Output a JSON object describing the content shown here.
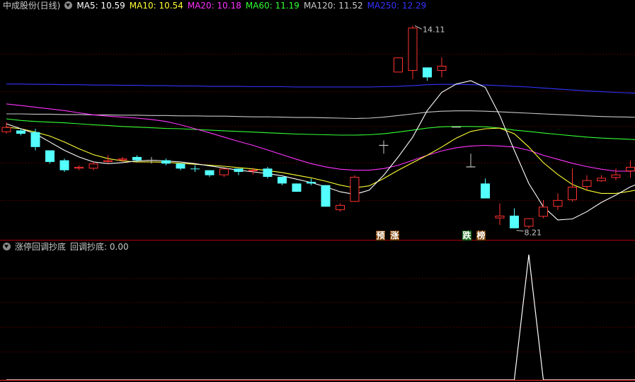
{
  "header": {
    "stock_name": "中成股份(日线)",
    "ma_labels": [
      {
        "text": "MA5: 10.59",
        "color": "#ffffff"
      },
      {
        "text": "MA10: 10.54",
        "color": "#ffff33"
      },
      {
        "text": "MA20: 10.18",
        "color": "#ff33ff"
      },
      {
        "text": "MA60: 11.19",
        "color": "#33ff33"
      },
      {
        "text": "MA120: 11.52",
        "color": "#c8c8c8"
      },
      {
        "text": "MA250: 12.29",
        "color": "#3333ff"
      }
    ]
  },
  "indicator": {
    "name": "涨停回调抄底",
    "value_label": "回调抄底: 0.00"
  },
  "signals": {
    "yu": "预",
    "zhang": "涨",
    "die": "跌",
    "bang": "榜"
  },
  "annotations": {
    "high": "14.11",
    "low": "8.21"
  },
  "colors": {
    "up": "#ff3232",
    "down": "#54ffff",
    "grid": "#7a0000",
    "separator": "#b00000",
    "ma5": "#ffffff",
    "ma10": "#ffff33",
    "ma20": "#ff33ff",
    "ma60": "#33ff33",
    "ma120": "#c8c8c8",
    "ma250": "#3333ff"
  },
  "chart_data": {
    "type": "candlestick",
    "ylim": [
      7.95,
      14.5
    ],
    "candles": [
      {
        "o": 10.9,
        "c": 11.05,
        "h": 11.2,
        "l": 10.85
      },
      {
        "o": 10.95,
        "c": 10.85,
        "h": 11.0,
        "l": 10.8
      },
      {
        "o": 10.9,
        "c": 10.45,
        "h": 11.0,
        "l": 10.35
      },
      {
        "o": 10.35,
        "c": 10.0,
        "h": 10.35,
        "l": 9.95
      },
      {
        "o": 10.05,
        "c": 9.75,
        "h": 10.1,
        "l": 9.7
      },
      {
        "o": 9.8,
        "c": 9.85,
        "h": 9.9,
        "l": 9.75
      },
      {
        "o": 9.8,
        "c": 9.95,
        "h": 10.0,
        "l": 9.75
      },
      {
        "o": 10.0,
        "c": 10.05,
        "h": 10.2,
        "l": 9.95
      },
      {
        "o": 10.05,
        "c": 10.1,
        "h": 10.15,
        "l": 10.0
      },
      {
        "o": 10.15,
        "c": 10.05,
        "h": 10.2,
        "l": 10.0
      },
      {
        "o": 10.05,
        "c": 10.05,
        "h": 10.15,
        "l": 9.95
      },
      {
        "o": 10.05,
        "c": 9.95,
        "h": 10.1,
        "l": 9.9
      },
      {
        "o": 9.95,
        "c": 9.8,
        "h": 9.95,
        "l": 9.75
      },
      {
        "o": 9.8,
        "c": 9.78,
        "h": 9.9,
        "l": 9.7
      },
      {
        "o": 9.75,
        "c": 9.6,
        "h": 9.75,
        "l": 9.55
      },
      {
        "o": 9.6,
        "c": 9.8,
        "h": 9.8,
        "l": 9.55
      },
      {
        "o": 9.8,
        "c": 9.7,
        "h": 9.8,
        "l": 9.6
      },
      {
        "o": 9.72,
        "c": 9.76,
        "h": 9.82,
        "l": 9.62
      },
      {
        "o": 9.8,
        "c": 9.55,
        "h": 9.85,
        "l": 9.5
      },
      {
        "o": 9.55,
        "c": 9.35,
        "h": 9.55,
        "l": 9.3
      },
      {
        "o": 9.35,
        "c": 9.1,
        "h": 9.35,
        "l": 9.1
      },
      {
        "o": 9.4,
        "c": 9.35,
        "h": 9.5,
        "l": 9.3
      },
      {
        "o": 9.3,
        "c": 8.65,
        "h": 9.3,
        "l": 8.65
      },
      {
        "o": 8.55,
        "c": 8.7,
        "h": 8.75,
        "l": 8.5
      },
      {
        "o": 8.8,
        "c": 9.55,
        "h": 9.6,
        "l": 8.8
      },
      {
        "o": null,
        "c": null,
        "h": null,
        "l": null
      },
      {
        "o": 10.5,
        "c": 10.5,
        "h": 10.65,
        "l": 10.25
      },
      {
        "o": 12.7,
        "c": 13.15,
        "h": 13.15,
        "l": 12.7
      },
      {
        "o": 12.75,
        "c": 14.05,
        "h": 14.11,
        "l": 12.5
      },
      {
        "o": 12.85,
        "c": 12.55,
        "h": 12.85,
        "l": 12.45
      },
      {
        "o": 12.75,
        "c": 12.9,
        "h": 13.15,
        "l": 12.55
      },
      {
        "o": 11.05,
        "c": 11.05,
        "h": 11.05,
        "l": 11.05
      },
      {
        "o": 9.85,
        "c": 9.85,
        "h": 10.25,
        "l": 9.85
      },
      {
        "o": 9.35,
        "c": 8.9,
        "h": 9.5,
        "l": 8.9
      },
      {
        "o": 8.3,
        "c": 8.38,
        "h": 8.75,
        "l": 8.1
      },
      {
        "o": 8.38,
        "c": 8.0,
        "h": 8.6,
        "l": 8.0
      },
      {
        "o": 8.05,
        "c": 8.3,
        "h": 8.3,
        "l": 8.0
      },
      {
        "o": 8.35,
        "c": 8.65,
        "h": 8.85,
        "l": 8.3
      },
      {
        "o": 8.65,
        "c": 8.85,
        "h": 9.05,
        "l": 8.55
      },
      {
        "o": 8.85,
        "c": 9.25,
        "h": 9.8,
        "l": 8.8
      },
      {
        "o": 9.25,
        "c": 9.45,
        "h": 9.6,
        "l": 9.15
      },
      {
        "o": 9.42,
        "c": 9.52,
        "h": 9.6,
        "l": 9.4
      },
      {
        "o": 9.52,
        "c": 9.62,
        "h": 9.8,
        "l": 9.45
      },
      {
        "o": 9.72,
        "c": 9.85,
        "h": 10.05,
        "l": 9.52
      },
      {
        "o": 9.85,
        "c": 9.55,
        "h": 10.1,
        "l": 9.55
      }
    ],
    "ma5": [
      11.15,
      11.0,
      10.85,
      10.6,
      10.35,
      10.15,
      10.0,
      9.95,
      9.98,
      10.03,
      10.05,
      10.03,
      10.0,
      9.95,
      9.88,
      9.82,
      9.75,
      9.7,
      9.65,
      9.58,
      9.48,
      9.38,
      9.25,
      9.1,
      9.02,
      9.15,
      9.6,
      10.15,
      10.75,
      11.55,
      12.1,
      12.35,
      12.45,
      12.25,
      11.4,
      10.35,
      9.35,
      8.65,
      8.25,
      8.28,
      8.5,
      8.78,
      9.0,
      9.25,
      9.42,
      9.5
    ],
    "ma10": [
      11.05,
      11.0,
      10.9,
      10.78,
      10.6,
      10.4,
      10.22,
      10.1,
      10.03,
      10.0,
      10.0,
      9.99,
      9.96,
      9.93,
      9.9,
      9.87,
      9.83,
      9.79,
      9.74,
      9.68,
      9.6,
      9.52,
      9.42,
      9.3,
      9.22,
      9.28,
      9.5,
      9.75,
      9.98,
      10.2,
      10.45,
      10.72,
      10.92,
      11.0,
      11.02,
      10.85,
      10.45,
      9.98,
      9.62,
      9.32,
      9.15,
      9.05,
      9.05,
      9.12,
      9.2,
      9.25
    ],
    "ma20": [
      11.75,
      11.7,
      11.65,
      11.6,
      11.55,
      11.48,
      11.42,
      11.38,
      11.35,
      11.32,
      11.28,
      11.22,
      11.12,
      11.0,
      10.88,
      10.75,
      10.62,
      10.5,
      10.36,
      10.22,
      10.08,
      9.95,
      9.85,
      9.78,
      9.75,
      9.75,
      9.8,
      9.9,
      10.05,
      10.2,
      10.33,
      10.43,
      10.48,
      10.5,
      10.48,
      10.45,
      10.35,
      10.2,
      10.08,
      9.96,
      9.86,
      9.78,
      9.72,
      9.72,
      9.75,
      9.78
    ],
    "ma60": [
      11.3,
      11.25,
      11.22,
      11.2,
      11.18,
      11.15,
      11.12,
      11.1,
      11.07,
      11.05,
      11.03,
      11.01,
      11.0,
      10.98,
      10.96,
      10.94,
      10.92,
      10.9,
      10.88,
      10.86,
      10.84,
      10.83,
      10.82,
      10.81,
      10.81,
      10.82,
      10.85,
      10.9,
      10.96,
      11.02,
      11.06,
      11.07,
      11.07,
      11.06,
      11.02,
      10.96,
      10.92,
      10.87,
      10.83,
      10.79,
      10.75,
      10.72,
      10.7,
      10.68,
      10.66,
      10.65
    ],
    "ma120": [
      11.45,
      11.45,
      11.44,
      11.44,
      11.43,
      11.43,
      11.42,
      11.42,
      11.41,
      11.41,
      11.4,
      11.4,
      11.39,
      11.39,
      11.38,
      11.38,
      11.37,
      11.36,
      11.36,
      11.35,
      11.34,
      11.34,
      11.33,
      11.32,
      11.31,
      11.32,
      11.35,
      11.4,
      11.45,
      11.5,
      11.53,
      11.54,
      11.54,
      11.53,
      11.51,
      11.49,
      11.47,
      11.45,
      11.43,
      11.41,
      11.39,
      11.37,
      11.36,
      11.35,
      11.34,
      11.33
    ],
    "ma250": [
      12.35,
      12.35,
      12.34,
      12.34,
      12.33,
      12.33,
      12.32,
      12.32,
      12.31,
      12.31,
      12.3,
      12.3,
      12.29,
      12.29,
      12.28,
      12.28,
      12.28,
      12.27,
      12.27,
      12.27,
      12.26,
      12.26,
      12.26,
      12.26,
      12.26,
      12.26,
      12.27,
      12.28,
      12.3,
      12.33,
      12.34,
      12.34,
      12.33,
      12.32,
      12.3,
      12.28,
      12.26,
      12.23,
      12.2,
      12.17,
      12.14,
      12.12,
      12.1,
      12.08,
      12.06,
      12.05
    ],
    "indicator_series": [
      0,
      0,
      0,
      0,
      0,
      0,
      0,
      0,
      0,
      0,
      0,
      0,
      0,
      0,
      0,
      0,
      0,
      0,
      0,
      0,
      0,
      0,
      0,
      0,
      0,
      0,
      0,
      0,
      0,
      0,
      0,
      0,
      0,
      0,
      0,
      0,
      1,
      0,
      0,
      0,
      0,
      0,
      0,
      0,
      0,
      0
    ]
  }
}
